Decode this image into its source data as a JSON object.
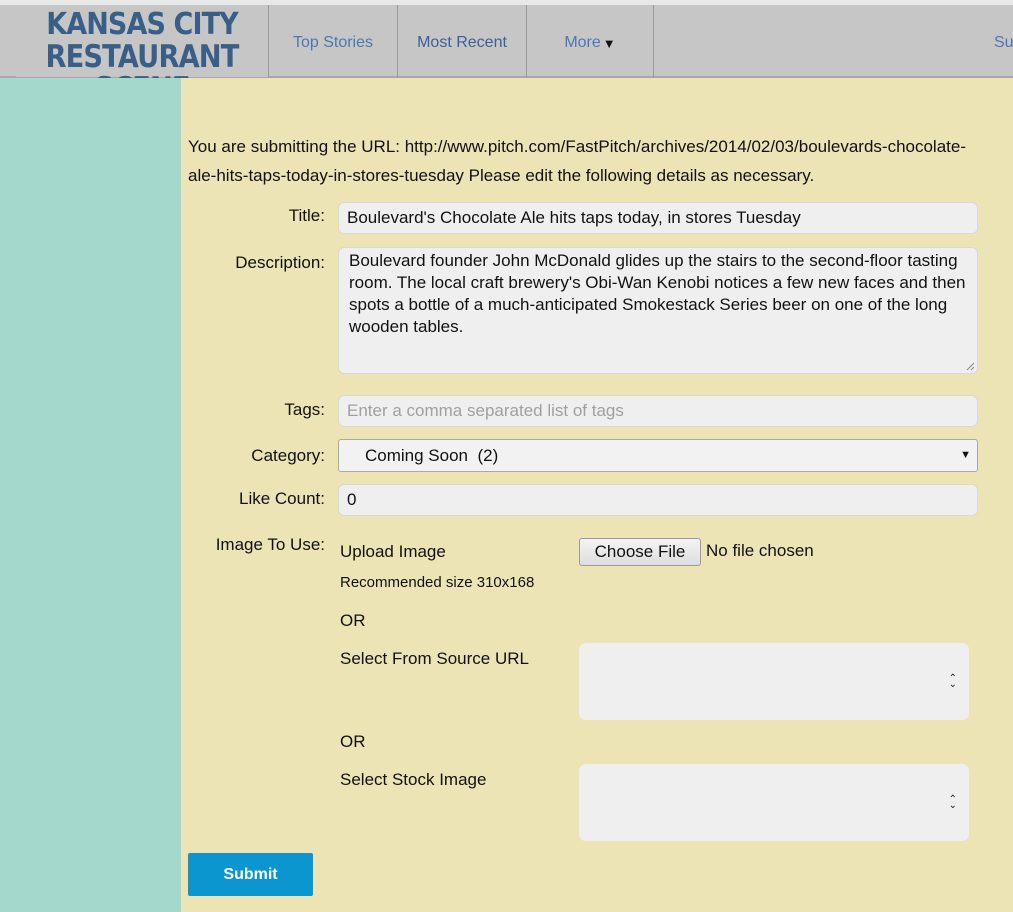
{
  "header": {
    "logo_line1": "KANSAS CITY",
    "logo_line2": "RESTAURANT SCENE",
    "nav": {
      "top_stories": "Top Stories",
      "most_recent": "Most Recent",
      "more": "More",
      "sub_partial": "Su"
    }
  },
  "form": {
    "intro": "You are submitting the URL: http://www.pitch.com/FastPitch/archives/2014/02/03/boulevards-chocolate-ale-hits-taps-today-in-stores-tuesday Please edit the following details as necessary.",
    "title_label": "Title:",
    "title_value": "Boulevard's Chocolate Ale hits taps today, in stores Tuesday",
    "description_label": "Description:",
    "description_value": "Boulevard founder John McDonald glides up the stairs to the second-floor tasting room. The local craft brewery's Obi-Wan Kenobi notices a few new faces and then spots a bottle of a much-anticipated Smokestack Series beer on one of the long wooden tables.",
    "tags_label": "Tags:",
    "tags_placeholder": "Enter a comma separated list of tags",
    "category_label": "Category:",
    "category_value": "Coming Soon  (2)",
    "like_label": "Like Count:",
    "like_value": "0",
    "image_label": "Image To Use:",
    "upload_label": "Upload Image",
    "recommended": "Recommended size 310x168",
    "choose_file": "Choose File",
    "no_file": "No file chosen",
    "or1": "OR",
    "source_url_label": "Select From Source URL",
    "or2": "OR",
    "stock_label": "Select Stock Image",
    "submit": "Submit"
  },
  "colors": {
    "accent": "#0c96cf",
    "content_bg": "#ede4b6",
    "sidebar_bg": "#a5d8cc",
    "nav_link": "#4a78b5"
  }
}
